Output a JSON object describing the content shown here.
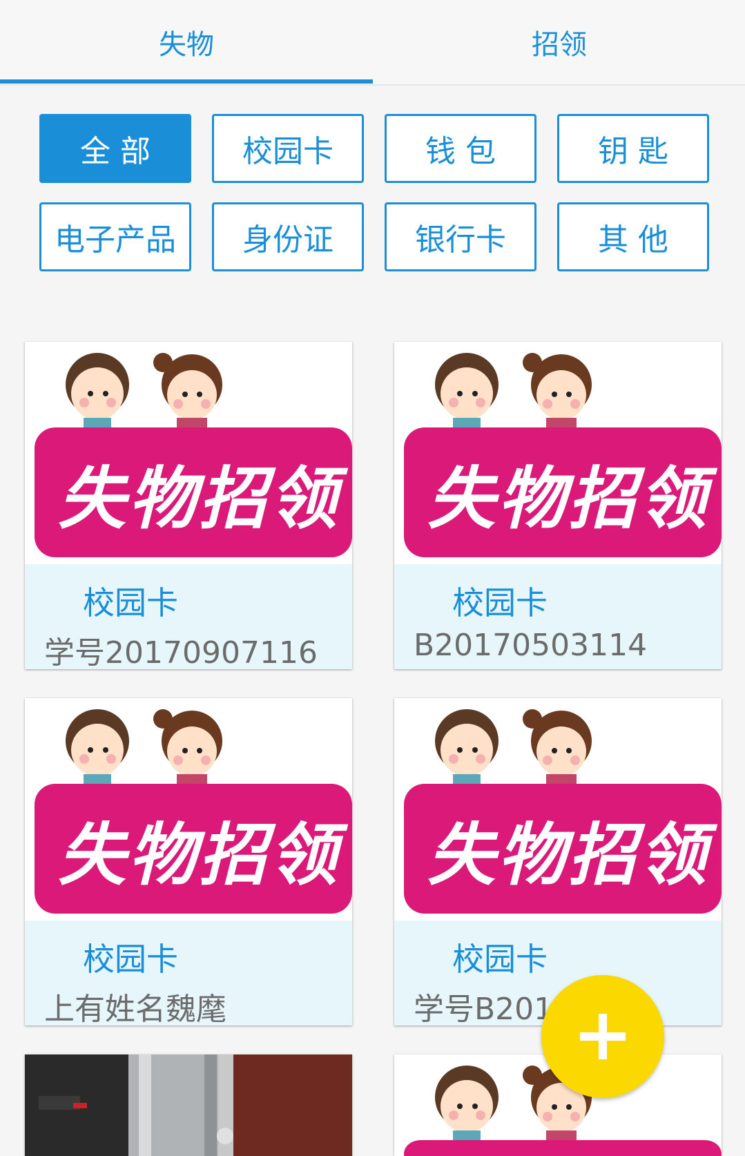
{
  "tabs": [
    {
      "label": "失物",
      "active": true
    },
    {
      "label": "招领",
      "active": false
    }
  ],
  "filters": [
    {
      "label": "全 部",
      "active": true
    },
    {
      "label": "校园卡",
      "active": false
    },
    {
      "label": "钱 包",
      "active": false
    },
    {
      "label": "钥 匙",
      "active": false
    },
    {
      "label": "电子产品",
      "active": false
    },
    {
      "label": "身份证",
      "active": false
    },
    {
      "label": "银行卡",
      "active": false
    },
    {
      "label": "其 他",
      "active": false
    }
  ],
  "items": [
    {
      "poster_text": "失物招领",
      "category": "校园卡",
      "desc": "学号20170907116"
    },
    {
      "poster_text": "失物招领",
      "category": "校园卡",
      "desc": "B20170503114"
    },
    {
      "poster_text": "失物招领",
      "category": "校园卡",
      "desc": "上有姓名魏麾"
    },
    {
      "poster_text": "失物招领",
      "category": "校园卡",
      "desc": "学号B201     219"
    },
    {
      "poster_text": "",
      "category": "",
      "desc": ""
    },
    {
      "poster_text": "",
      "category": "",
      "desc": ""
    }
  ],
  "fab": {
    "icon": "plus-icon"
  },
  "colors": {
    "accent": "#1a8fd8",
    "banner": "#db1979",
    "info_bg": "#e6f6fb",
    "fab": "#fbd800"
  }
}
